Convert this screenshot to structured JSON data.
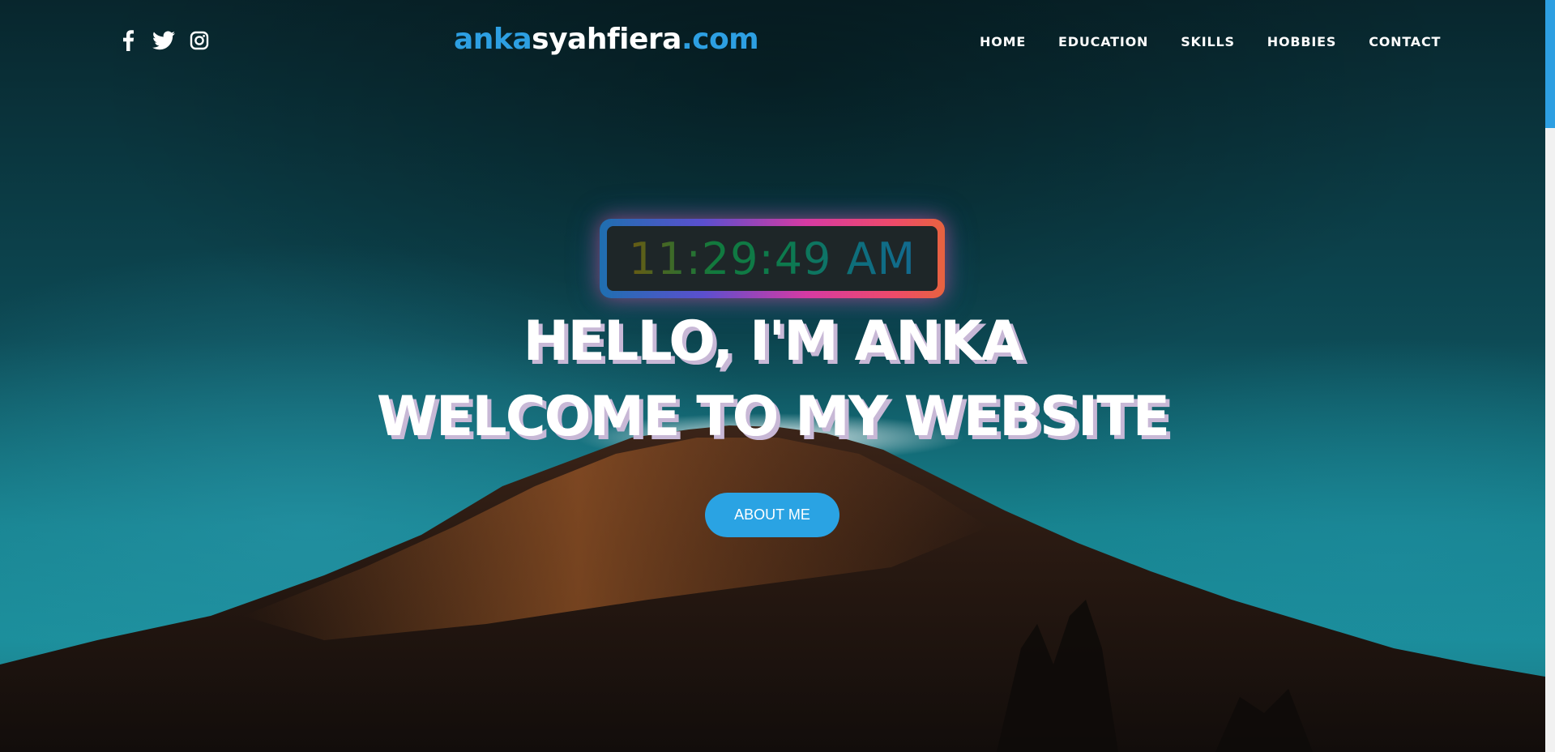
{
  "site": {
    "brand_part1": "anka",
    "brand_part2": "syahfiera",
    "brand_part3": ".com"
  },
  "socials": [
    {
      "icon": "facebook-icon"
    },
    {
      "icon": "twitter-icon"
    },
    {
      "icon": "instagram-icon"
    }
  ],
  "nav": {
    "home": "HOME",
    "education": "EDUCATION",
    "skills": "SKILLS",
    "hobbies": "HOBBIES",
    "contact": "CONTACT"
  },
  "hero": {
    "clock_time": "11:29:49 AM",
    "headline_line1": "HELLO, I'M ANKA",
    "headline_line2": "WELCOME TO MY WEBSITE",
    "cta_label": "ABOUT ME"
  },
  "colors": {
    "accent": "#2d9fe2",
    "button": "#2aa3e3",
    "text": "#ffffff"
  }
}
